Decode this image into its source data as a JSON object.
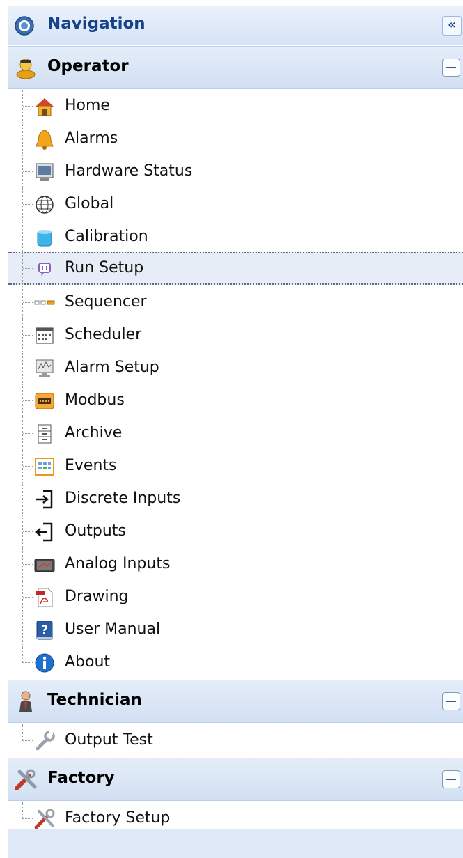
{
  "navigation": {
    "title": "Navigation",
    "collapse_label": "«"
  },
  "sections": {
    "operator": {
      "title": "Operator",
      "items": [
        {
          "label": "Home",
          "icon": "home-icon"
        },
        {
          "label": "Alarms",
          "icon": "bell-icon"
        },
        {
          "label": "Hardware Status",
          "icon": "monitor-icon"
        },
        {
          "label": "Global",
          "icon": "globe-icon"
        },
        {
          "label": "Calibration",
          "icon": "cylinder-icon"
        },
        {
          "label": "Run Setup",
          "icon": "chat-icon",
          "selected": true
        },
        {
          "label": "Sequencer",
          "icon": "sequence-icon"
        },
        {
          "label": "Scheduler",
          "icon": "calendar-icon"
        },
        {
          "label": "Alarm Setup",
          "icon": "alarm-monitor-icon"
        },
        {
          "label": "Modbus",
          "icon": "modbus-icon"
        },
        {
          "label": "Archive",
          "icon": "cabinet-icon"
        },
        {
          "label": "Events",
          "icon": "events-grid-icon"
        },
        {
          "label": "Discrete Inputs",
          "icon": "input-arrow-icon"
        },
        {
          "label": "Outputs",
          "icon": "output-arrow-icon"
        },
        {
          "label": "Analog Inputs",
          "icon": "analog-meter-icon"
        },
        {
          "label": "Drawing",
          "icon": "pdf-icon"
        },
        {
          "label": "User Manual",
          "icon": "help-book-icon"
        },
        {
          "label": "About",
          "icon": "info-icon"
        }
      ]
    },
    "technician": {
      "title": "Technician",
      "items": [
        {
          "label": "Output Test",
          "icon": "wrench-icon"
        }
      ]
    },
    "factory": {
      "title": "Factory",
      "items": [
        {
          "label": "Factory Setup",
          "icon": "tools-icon"
        }
      ]
    }
  },
  "colors": {
    "header_text": "#15428b",
    "header_bg": "#d7e4f5",
    "selected_bg": "#e6edf6"
  }
}
